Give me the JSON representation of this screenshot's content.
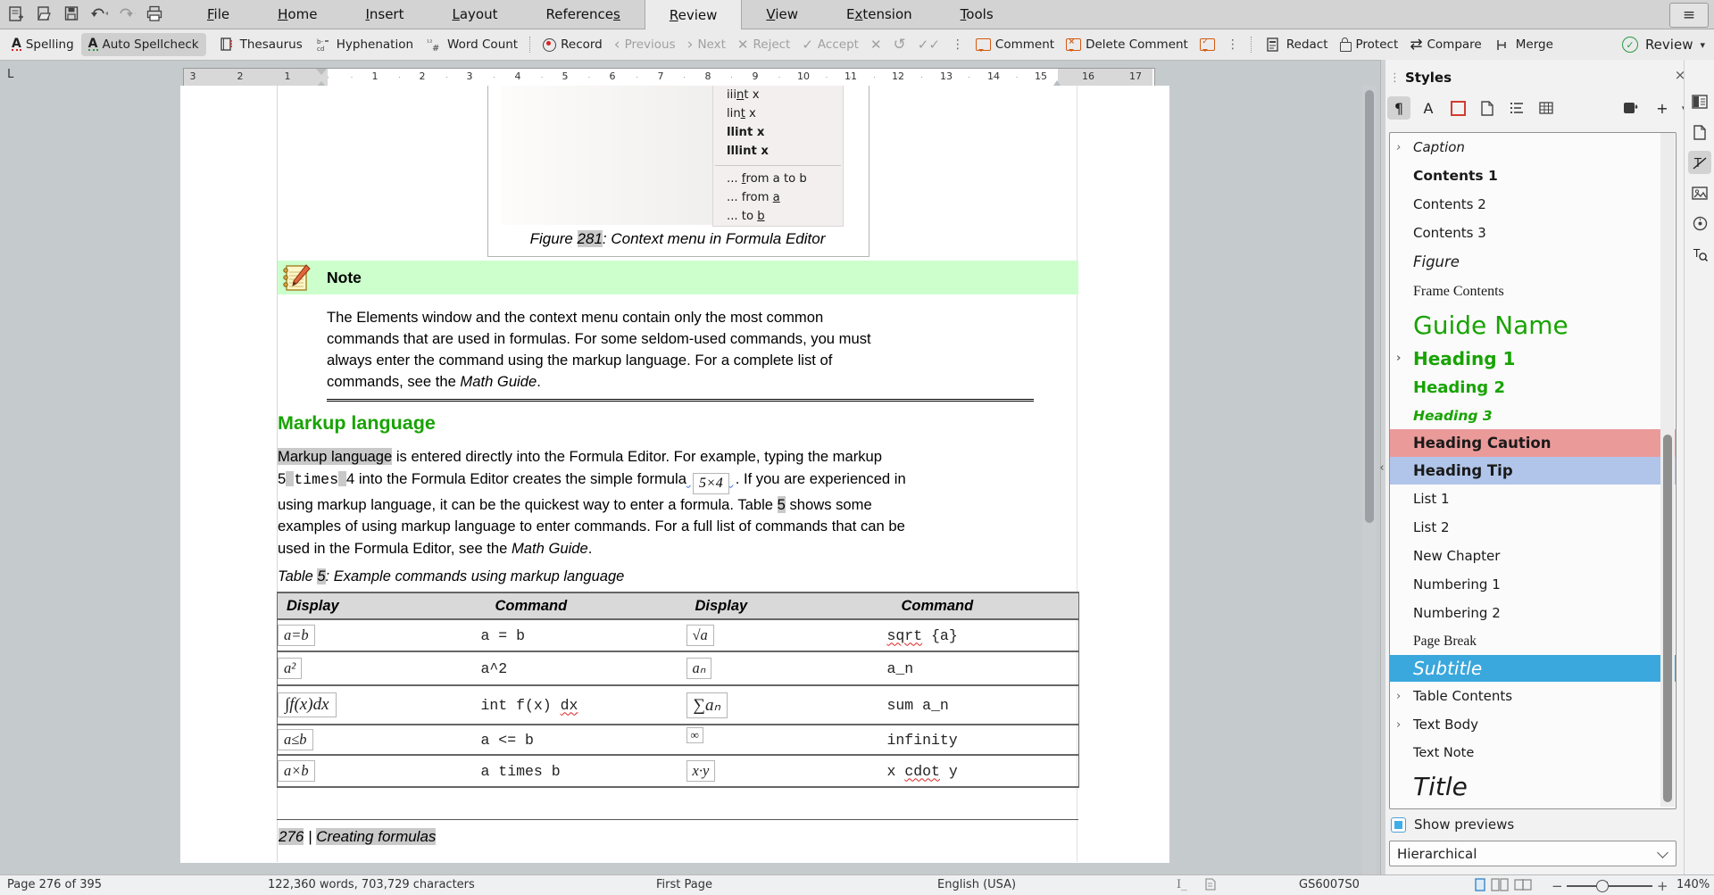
{
  "colors": {
    "accent_green": "#18a303",
    "selection_blue": "#3aa7dd",
    "note_green": "#ccffcc",
    "caution_red": "#eb9a9a",
    "tip_blue": "#b0c5e9",
    "field_shading": "#c9c9c9",
    "comment_orange": "#d45a12"
  },
  "tabs": {
    "file": {
      "pre": "",
      "u": "F",
      "post": "ile"
    },
    "home": {
      "pre": "",
      "u": "H",
      "post": "ome"
    },
    "insert": {
      "pre": "",
      "u": "I",
      "post": "nsert"
    },
    "layout": {
      "pre": "",
      "u": "L",
      "post": "ayout"
    },
    "references": {
      "pre": "Reference",
      "u": "s",
      "post": ""
    },
    "review": {
      "pre": "",
      "u": "R",
      "post": "eview"
    },
    "view": {
      "pre": "",
      "u": "V",
      "post": "iew"
    },
    "extension": {
      "pre": "E",
      "u": "x",
      "post": "tension"
    },
    "tools": {
      "pre": "",
      "u": "T",
      "post": "ools"
    },
    "hamburger": "≡"
  },
  "toolbar": {
    "spelling": "Spelling",
    "auto_spellcheck": "Auto Spellcheck",
    "thesaurus": "Thesaurus",
    "hyphenation": "Hyphenation",
    "word_count": "Word Count",
    "record": "Record",
    "previous": "Previous",
    "next": "Next",
    "reject": "Reject",
    "accept": "Accept",
    "comment": "Comment",
    "delete_comment": "Delete Comment",
    "redact": "Redact",
    "protect": "Protect",
    "compare": "Compare",
    "merge": "Merge",
    "review_mode": "Review"
  },
  "ruler": {
    "neg": [
      "3",
      "2",
      "1"
    ],
    "pos": [
      "1",
      "2",
      "3",
      "4",
      "5",
      "6",
      "7",
      "8",
      "9",
      "10",
      "11",
      "12",
      "13",
      "14",
      "15"
    ],
    "over": [
      "16",
      "17"
    ],
    "corner": "L"
  },
  "document": {
    "context_menu": {
      "items_top": [
        {
          "pre": "iii",
          "u": "n",
          "post": "t x"
        },
        {
          "pre": "lin",
          "u": "t",
          "post": " x"
        },
        {
          "pre": "llint x",
          "u": "",
          "post": ""
        },
        {
          "pre": "lllint x",
          "u": "",
          "post": ""
        }
      ],
      "items_bottom": [
        {
          "pre": "... ",
          "u": "f",
          "post": "rom a to b"
        },
        {
          "pre": "... from ",
          "u": "a",
          "post": ""
        },
        {
          "pre": "... to ",
          "u": "b",
          "post": ""
        }
      ]
    },
    "figure_caption": {
      "pre": "Figure ",
      "num": "281",
      "post": ": Context menu in Formula Editor"
    },
    "note": {
      "title": "Note",
      "line1": "The Elements window and the context menu contain only the most common",
      "line2": "commands that are used in formulas. For some seldom-used commands, you must",
      "line3": "always enter the command using the markup language. For a complete list of",
      "line4": "commands, see the ",
      "italic": "Math Guide",
      "tail": "."
    },
    "heading": "Markup language",
    "para": {
      "l1a": "Markup language",
      "l1b": " is entered directly into the Formula Editor. For example, typing the markup",
      "l2a": "5",
      "l2b": "times",
      "l2c": "4 into the Formula Editor creates the simple formula",
      "formula": "5×4",
      "l2d": ". If you are experienced in",
      "l3a": "using markup language, it can be the quickest way to enter a formula. Table ",
      "l3b": "5",
      "l3c": " shows some",
      "l4": "examples of using markup language to enter commands. For a full list of commands that can be",
      "l5a": "used in the Formula Editor, see the ",
      "l5b": "Math Guide",
      "l5c": "."
    },
    "table_caption": {
      "pre": "Table ",
      "num": "5",
      "post": ": Example commands using markup language"
    },
    "table": {
      "headers": [
        "Display",
        "Command",
        "Display",
        "Command"
      ],
      "rows": [
        {
          "d1": "a=b",
          "c1": {
            "pre": "a = b",
            "wavy": "",
            "post": ""
          },
          "d2": "√a",
          "c2": {
            "pre": "",
            "wavy": "sqrt",
            "post": " {a}"
          }
        },
        {
          "d1": "a²",
          "c1": {
            "pre": "a^2",
            "wavy": "",
            "post": ""
          },
          "d2": "aₙ",
          "c2": {
            "pre": "a_n",
            "wavy": "",
            "post": ""
          }
        },
        {
          "d1": "∫f(x)dx",
          "c1": {
            "pre": "int f(x) ",
            "wavy": "dx",
            "post": ""
          },
          "d2": "∑aₙ",
          "c2": {
            "pre": "sum a_n",
            "wavy": "",
            "post": ""
          }
        },
        {
          "d1": "a≤b",
          "c1": {
            "pre": "a <= b",
            "wavy": "",
            "post": ""
          },
          "d2": "∞",
          "c2": {
            "pre": "infinity",
            "wavy": "",
            "post": ""
          }
        },
        {
          "d1": "a×b",
          "c1": {
            "pre": "a times b",
            "wavy": "",
            "post": ""
          },
          "d2": "x·y",
          "c2": {
            "pre": "x ",
            "wavy": "cdot",
            "post": " y"
          }
        }
      ]
    },
    "footer": {
      "page": "276",
      "sep": " | ",
      "title": "Creating formulas"
    }
  },
  "sidebar": {
    "title": "Styles",
    "close": "×",
    "items": [
      {
        "label": "Caption"
      },
      {
        "label": "Contents 1"
      },
      {
        "label": "Contents 2"
      },
      {
        "label": "Contents 3"
      },
      {
        "label": "Figure"
      },
      {
        "label": "Frame Contents"
      },
      {
        "label": "Guide Name"
      },
      {
        "label": "Heading 1"
      },
      {
        "label": "Heading 2"
      },
      {
        "label": "Heading 3"
      },
      {
        "label": "Heading Caution"
      },
      {
        "label": "Heading Tip"
      },
      {
        "label": "List 1"
      },
      {
        "label": "List 2"
      },
      {
        "label": "New Chapter"
      },
      {
        "label": "Numbering 1"
      },
      {
        "label": "Numbering 2"
      },
      {
        "label": "Page Break"
      },
      {
        "label": "Subtitle"
      },
      {
        "label": "Table Contents"
      },
      {
        "label": "Text Body"
      },
      {
        "label": "Text Note"
      },
      {
        "label": "Title"
      }
    ],
    "show_previews": "Show previews",
    "filter_mode": "Hierarchical"
  },
  "statusbar": {
    "page": "Page 276 of 395",
    "words": "122,360 words, 703,729 characters",
    "page_style": "First Page",
    "language": "English (USA)",
    "doc_info": "GS6007S0",
    "zoom": "140%"
  }
}
